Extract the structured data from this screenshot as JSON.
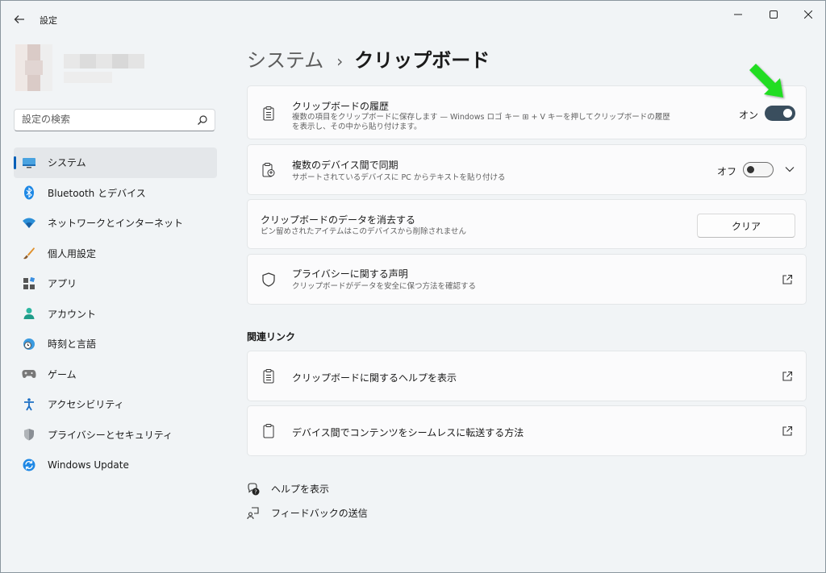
{
  "window": {
    "title": "設定"
  },
  "search": {
    "placeholder": "設定の検索"
  },
  "nav": {
    "items": [
      {
        "label": "システム",
        "icon": "system-icon",
        "active": true
      },
      {
        "label": "Bluetooth とデバイス",
        "icon": "bluetooth-icon"
      },
      {
        "label": "ネットワークとインターネット",
        "icon": "wifi-icon"
      },
      {
        "label": "個人用設定",
        "icon": "brush-icon"
      },
      {
        "label": "アプリ",
        "icon": "apps-icon"
      },
      {
        "label": "アカウント",
        "icon": "account-icon"
      },
      {
        "label": "時刻と言語",
        "icon": "globe-clock-icon"
      },
      {
        "label": "ゲーム",
        "icon": "gamepad-icon"
      },
      {
        "label": "アクセシビリティ",
        "icon": "accessibility-icon"
      },
      {
        "label": "プライバシーとセキュリティ",
        "icon": "shield-icon"
      },
      {
        "label": "Windows Update",
        "icon": "update-icon"
      }
    ]
  },
  "breadcrumb": {
    "parent": "システム",
    "separator": "›",
    "current": "クリップボード"
  },
  "cards": {
    "history": {
      "title": "クリップボードの履歴",
      "desc_line1": "複数の項目をクリップボードに保存します — Windows ロゴ キー ⊞ + V キーを押してクリップボードの履歴",
      "desc_line2": "を表示し、その中から貼り付けます。",
      "toggle_label": "オン",
      "toggle_state": true
    },
    "sync": {
      "title": "複数のデバイス間で同期",
      "desc": "サポートされているデバイスに PC からテキストを貼り付ける",
      "toggle_label": "オフ",
      "toggle_state": false
    },
    "clear": {
      "title": "クリップボードのデータを消去する",
      "desc": "ピン留めされたアイテムはこのデバイスから削除されません",
      "button_label": "クリア"
    },
    "privacy": {
      "title": "プライバシーに関する声明",
      "desc": "クリップボードがデータを安全に保つ方法を確認する"
    }
  },
  "related": {
    "heading": "関連リンク",
    "links": [
      {
        "label": "クリップボードに関するヘルプを表示"
      },
      {
        "label": "デバイス間でコンテンツをシームレスに転送する方法"
      }
    ]
  },
  "footer": {
    "help": "ヘルプを表示",
    "feedback": "フィードバックの送信"
  },
  "colors": {
    "accent": "#005fb8",
    "toggle_on": "#3a4e5e",
    "annotation_arrow": "#22dd22"
  }
}
